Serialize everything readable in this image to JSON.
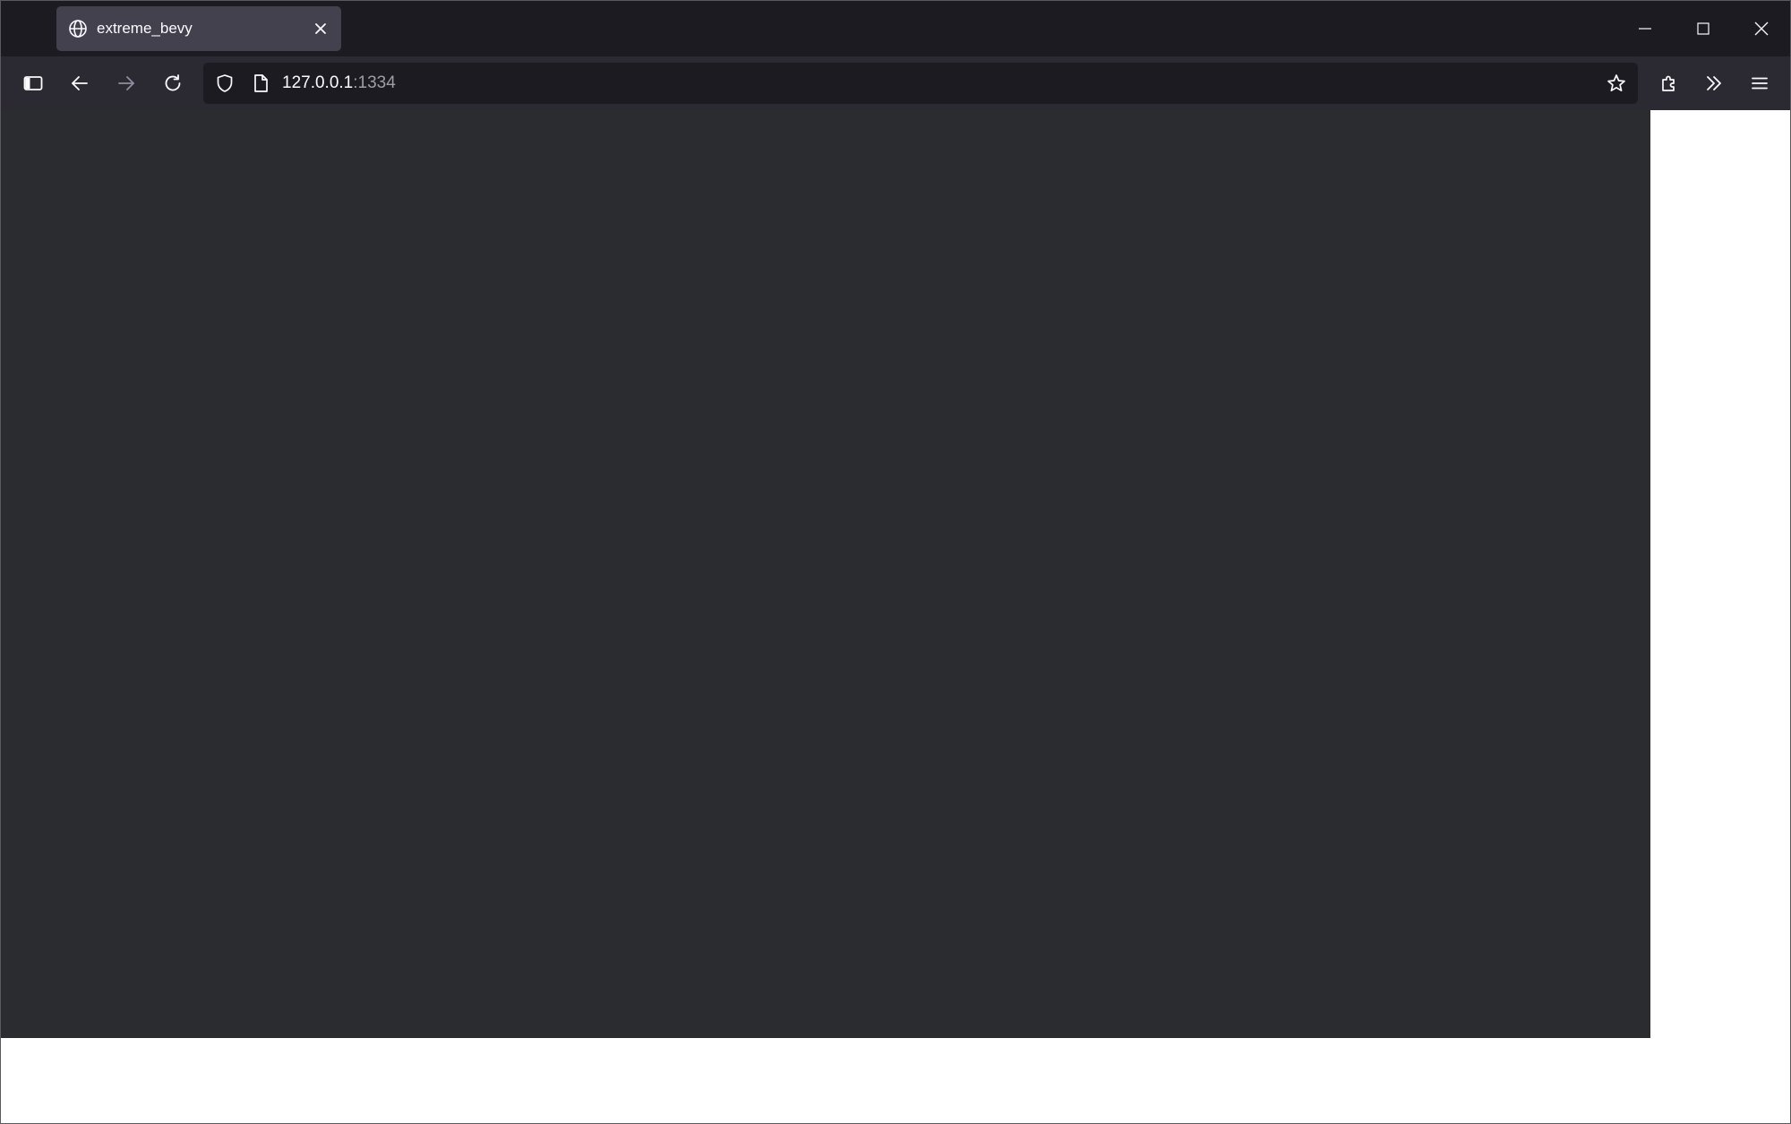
{
  "tab": {
    "title": "extreme_bevy",
    "icon": "globe-icon",
    "close_icon": "close-icon"
  },
  "window_controls": {
    "minimize_icon": "minimize-icon",
    "maximize_icon": "maximize-icon",
    "close_icon": "close-icon"
  },
  "toolbar": {
    "sidebar_icon": "sidebar-icon",
    "back_icon": "arrow-left-icon",
    "forward_icon": "arrow-right-icon",
    "reload_icon": "reload-icon",
    "extensions_icon": "puzzle-icon",
    "overflow_icon": "chevron-double-right-icon",
    "menu_icon": "hamburger-menu-icon"
  },
  "urlbar": {
    "host": "127.0.0.1",
    "port": ":1334",
    "shield_icon": "shield-icon",
    "page_icon": "page-icon",
    "bookmark_icon": "star-icon"
  },
  "colors": {
    "titlebar": "#1c1b22",
    "tab_active": "#42414d",
    "toolbar": "#2b2a33",
    "urlbar": "#1c1b22",
    "canvas": "#2b2c30",
    "page_background": "#ffffff"
  }
}
